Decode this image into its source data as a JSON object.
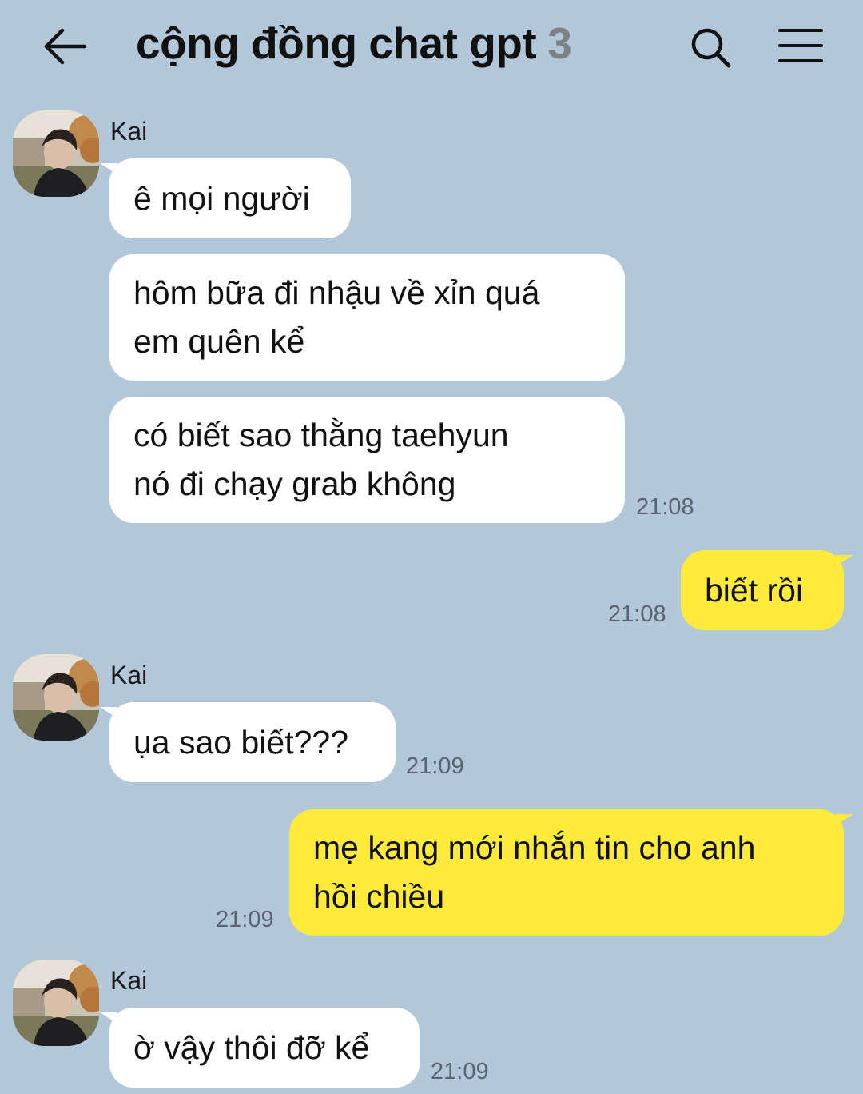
{
  "header": {
    "title": "cộng đồng chat gpt",
    "member_count": "3",
    "back_icon": "arrow-left-icon",
    "search_icon": "search-icon",
    "menu_icon": "hamburger-menu-icon"
  },
  "colors": {
    "background": "#b2c7da",
    "incoming_bubble": "#ffffff",
    "outgoing_bubble": "#fdea3b",
    "timestamp": "#5a6470"
  },
  "messages": {
    "g1": {
      "sender": "Kai",
      "m1": "ê mọi người",
      "m2_l1": "hôm bữa đi nhậu về xỉn quá",
      "m2_l2": "em quên kể",
      "m3_l1": "có biết sao thằng taehyun",
      "m3_l2": "nó đi chạy grab không",
      "time": "21:08"
    },
    "o1": {
      "text": "biết rồi",
      "time": "21:08"
    },
    "g2": {
      "sender": "Kai",
      "m1": "ụa sao biết???",
      "time": "21:09"
    },
    "o2": {
      "l1": "mẹ kang mới nhắn tin cho anh",
      "l2": "hồi chiều",
      "time": "21:09"
    },
    "g3": {
      "sender": "Kai",
      "m1": "ờ vậy thôi đỡ kể",
      "time": "21:09"
    }
  }
}
